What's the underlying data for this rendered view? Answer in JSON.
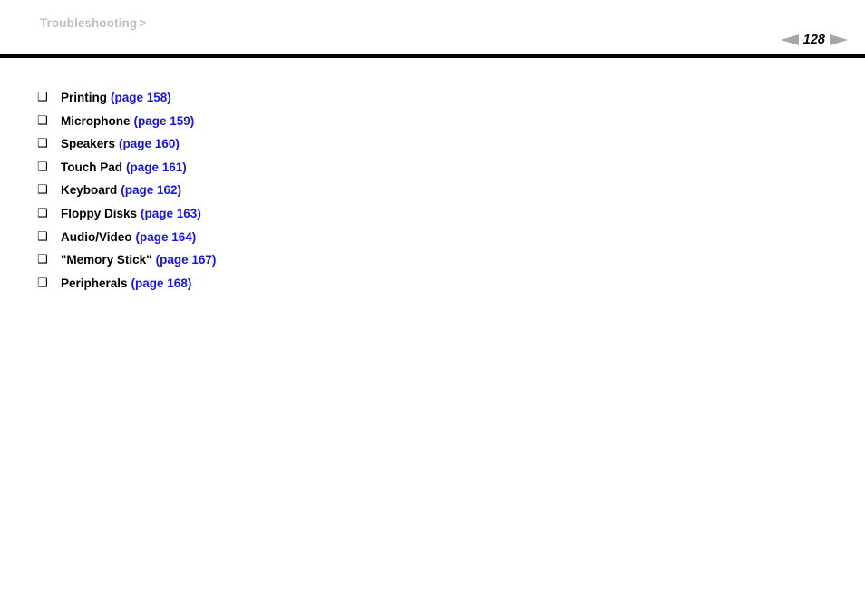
{
  "header": {
    "breadcrumb": "Troubleshooting",
    "breadcrumb_separator": ">",
    "page_number": "128",
    "prev_arrow_icon": "triangle-left-icon",
    "next_arrow_icon": "triangle-right-icon"
  },
  "colors": {
    "breadcrumb_gray": "#bfbfbf",
    "arrow_gray": "#a6a6a6",
    "link_blue": "#1414e6",
    "rule_black": "#000000",
    "background": "#ffffff"
  },
  "list": {
    "bullet_glyph": "❑",
    "items": [
      {
        "label": "Printing",
        "pageref": "(page 158)"
      },
      {
        "label": "Microphone",
        "pageref": "(page 159)"
      },
      {
        "label": "Speakers",
        "pageref": "(page 160)"
      },
      {
        "label": "Touch Pad",
        "pageref": "(page 161)"
      },
      {
        "label": "Keyboard",
        "pageref": "(page 162)"
      },
      {
        "label": "Floppy Disks",
        "pageref": "(page 163)"
      },
      {
        "label": "Audio/Video",
        "pageref": "(page 164)"
      },
      {
        "label": "\"Memory Stick\"",
        "pageref": "(page 167)"
      },
      {
        "label": "Peripherals",
        "pageref": "(page 168)"
      }
    ]
  }
}
